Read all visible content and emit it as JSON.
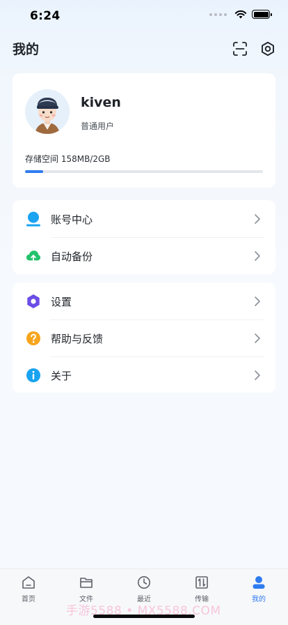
{
  "status_bar": {
    "time": "6:24"
  },
  "header": {
    "title": "我的"
  },
  "profile": {
    "username": "kiven",
    "role": "普通用户",
    "storage_label": "存储空间 158MB/2GB",
    "storage_used_fraction": 0.077
  },
  "menu_group_1": [
    {
      "label": "账号中心",
      "icon": "user-icon"
    },
    {
      "label": "自动备份",
      "icon": "cloud-upload-icon"
    }
  ],
  "menu_group_2": [
    {
      "label": "设置",
      "icon": "settings-icon"
    },
    {
      "label": "帮助与反馈",
      "icon": "help-icon"
    },
    {
      "label": "关于",
      "icon": "info-icon"
    }
  ],
  "tabs": [
    {
      "label": "首页",
      "icon": "home-icon"
    },
    {
      "label": "文件",
      "icon": "folder-icon"
    },
    {
      "label": "最近",
      "icon": "clock-icon"
    },
    {
      "label": "传输",
      "icon": "transfer-icon"
    },
    {
      "label": "我的",
      "icon": "person-icon",
      "active": true
    }
  ],
  "watermark": "手游5588 • MX5588.COM",
  "colors": {
    "accent": "#2f7cf0",
    "icon_blue": "#1aa3f0",
    "icon_green": "#23c26b",
    "icon_purple": "#6b4de6",
    "icon_orange": "#f7a51c"
  }
}
